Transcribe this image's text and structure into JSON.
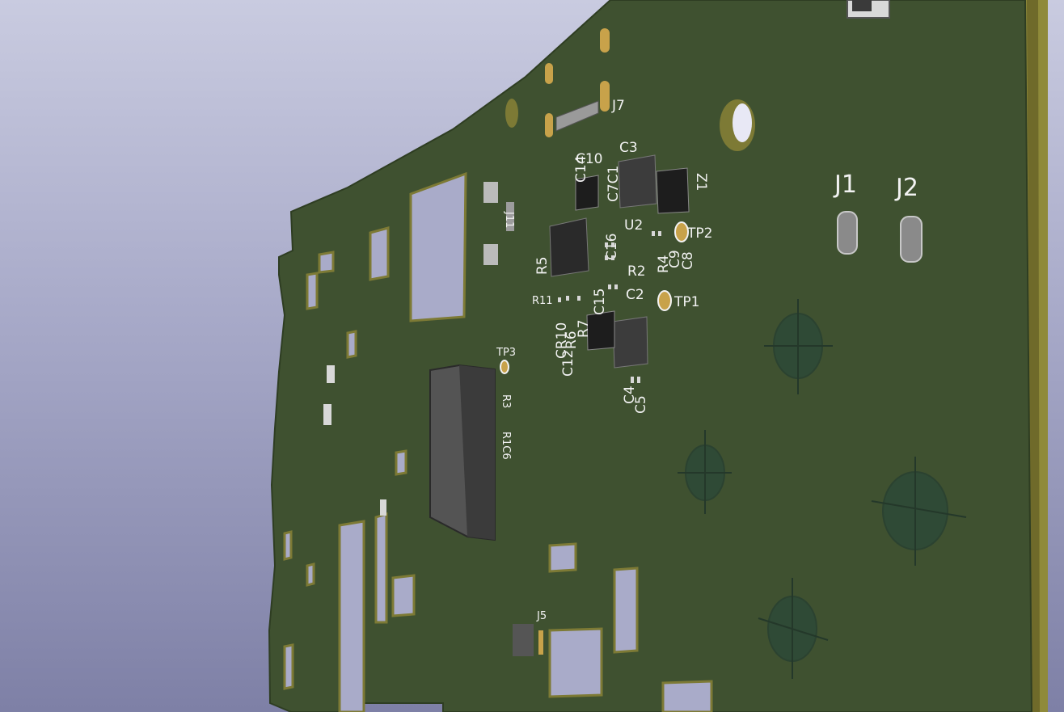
{
  "colors": {
    "background_top": "#c9cbe0",
    "background_bottom": "#7e80a6",
    "board_face": "#3f5130",
    "board_edge": "#8f8a3a",
    "silkscreen": "#f2f2f2",
    "pad_gold": "#c8a24a",
    "copper_fill": "#2f4a36",
    "chip_body": "#2a2a2a"
  },
  "refdes": {
    "j1": "J1",
    "j2": "J2",
    "j5": "J5",
    "j7": "J7",
    "j11": "J11",
    "tp1": "TP1",
    "tp2": "TP2",
    "tp3": "TP3",
    "u2": "U2",
    "c2": "C2",
    "c3": "C3",
    "c4": "C4",
    "c5": "C5",
    "c8": "C8",
    "c9": "C9",
    "c12": "C12",
    "c15": "C15",
    "c16": "C16",
    "c7c1": "C7C1",
    "c10": "C10",
    "c14": "C14",
    "r2": "R2",
    "r3": "R3",
    "r4": "R4",
    "r5": "R5",
    "r6": "R6",
    "r7": "R7",
    "r11": "R11",
    "cr10": "CR10",
    "r1c6": "R1C6",
    "z1": "Z1"
  }
}
